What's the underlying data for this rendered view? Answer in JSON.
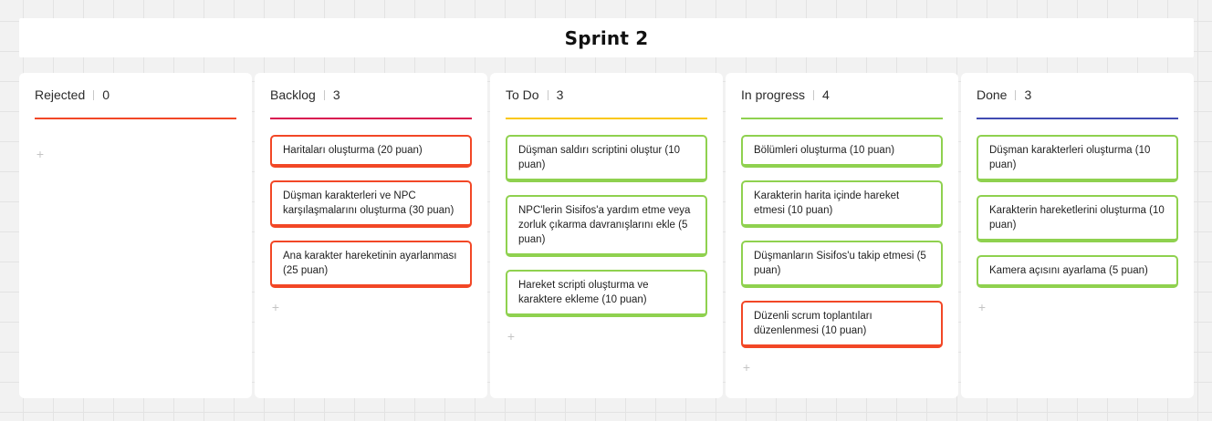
{
  "board": {
    "title": "Sprint 2"
  },
  "columns": [
    {
      "name": "Rejected",
      "count": "0",
      "rule_color": "#f24726",
      "cards": []
    },
    {
      "name": "Backlog",
      "count": "3",
      "rule_color": "#d9104f",
      "cards": [
        {
          "text": "Haritaları oluşturma (20 puan)",
          "color": "red"
        },
        {
          "text": "Düşman karakterleri ve NPC karşılaşmalarını oluşturma (30 puan)",
          "color": "red"
        },
        {
          "text": "Ana karakter hareketinin ayarlanması (25 puan)",
          "color": "red"
        }
      ]
    },
    {
      "name": "To Do",
      "count": "3",
      "rule_color": "#fac710",
      "cards": [
        {
          "text": "Düşman saldırı scriptini oluştur (10 puan)",
          "color": "green"
        },
        {
          "text": "NPC'lerin Sisifos'a yardım etme veya zorluk çıkarma davranışlarını ekle (5 puan)",
          "color": "green"
        },
        {
          "text": "Hareket scripti oluşturma ve karaktere ekleme (10 puan)",
          "color": "green"
        }
      ]
    },
    {
      "name": "In progress",
      "count": "4",
      "rule_color": "#8fd14f",
      "cards": [
        {
          "text": "Bölümleri oluşturma (10 puan)",
          "color": "green"
        },
        {
          "text": "Karakterin harita içinde hareket etmesi (10 puan)",
          "color": "green"
        },
        {
          "text": "Düşmanların Sisifos'u takip etmesi (5 puan)",
          "color": "green"
        },
        {
          "text": "Düzenli scrum toplantıları düzenlenmesi (10 puan)",
          "color": "red"
        }
      ]
    },
    {
      "name": "Done",
      "count": "3",
      "rule_color": "#414bb2",
      "cards": [
        {
          "text": "Düşman karakterleri oluşturma (10 puan)",
          "color": "green"
        },
        {
          "text": "Karakterin hareketlerini oluşturma (10 puan)",
          "color": "green"
        },
        {
          "text": "Kamera açısını ayarlama (5 puan)",
          "color": "green"
        }
      ]
    }
  ],
  "add_symbol": "+"
}
